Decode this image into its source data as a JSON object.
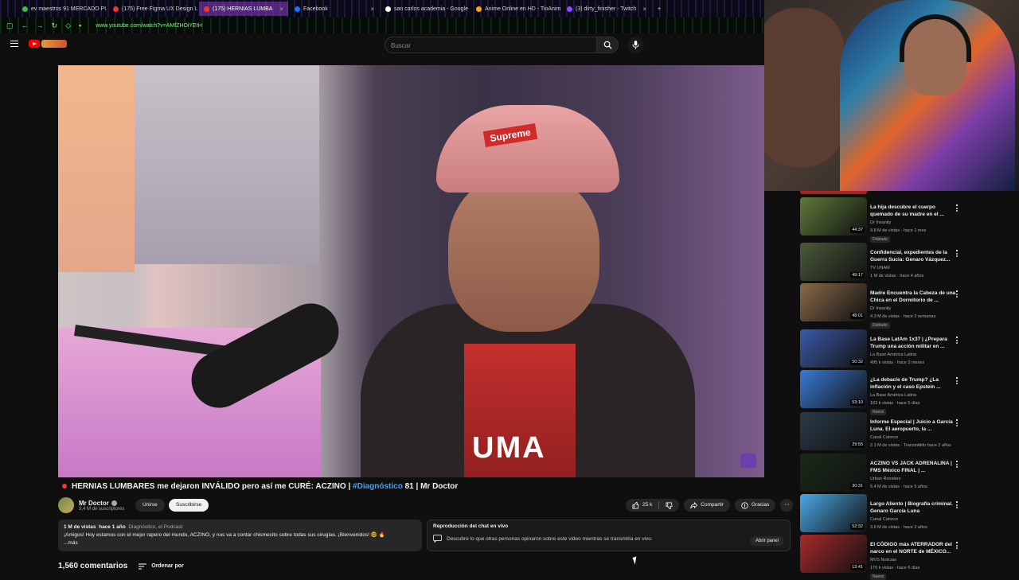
{
  "browser": {
    "tabs": [
      {
        "label": "ev maestros 91 MERCADO PUE",
        "color": "#4caf50",
        "active": false
      },
      {
        "label": "(175) Free Figma UX Design UI",
        "color": "#e53935",
        "active": false
      },
      {
        "label": "(175) HERNIAS LUMBA",
        "color": "#e53935",
        "active": true
      },
      {
        "label": "Facebook",
        "color": "#1877f2",
        "active": false
      },
      {
        "label": "san carlos academia - Google",
        "color": "#ffffff",
        "active": false
      },
      {
        "label": "Anime Online en HD - TioAnim",
        "color": "#f5a623",
        "active": false
      },
      {
        "label": "(3) dirty_finisher - Twitch",
        "color": "#9146ff",
        "active": false
      }
    ],
    "new_tab": "+",
    "url": "www.youtube.com/watch?v=AMfZHOiYEtH"
  },
  "header": {
    "search_placeholder": "Buscar"
  },
  "video": {
    "shirt_text": "UMA",
    "cap_text": "Supreme",
    "title_main": "HERNIAS LUMBARES me dejaron INVÁLIDO pero así me CURÉ: ACZINO | ",
    "title_tag": "#Diagnóstico",
    "title_end": " 81 | Mr Doctor"
  },
  "channel": {
    "name": "Mr Doctor",
    "subs": "3,4 M de suscriptores",
    "join": "Unirse",
    "subscribe": "Suscribirse"
  },
  "actions": {
    "likes": "25 k",
    "share": "Compartir",
    "thanks": "Gracias"
  },
  "description": {
    "views": "1 M de vistas",
    "date": "hace 1 año",
    "hashtags": "Diagnóstico, el Podcast",
    "text": "¡Amigos! Hoy estamos con el mejor rapero del mundo, ACZINO, y nos va a contar chismecito sobre todas sus cirugías. ¡Bienvenidos! 🤓 🔥",
    "more": "...más"
  },
  "chat": {
    "title": "Reproducción del chat en vivo",
    "text": "Descubre lo que otras personas opinaron sobre este video mientras se transmitía en vivo.",
    "open": "Abrir panel"
  },
  "comments": {
    "count": "1,560 comentarios",
    "sort": "Ordenar por"
  },
  "recommendations": [
    {
      "title": "La hija descubre el cuerpo quemado de su madre en el ...",
      "channel": "Dr Insanity",
      "views": "9.8 M de vistas · hace 1 mes",
      "badge": "Doblado",
      "duration": "44:37",
      "color": "#5f7a3a"
    },
    {
      "title": "Confidencial, expedientes de la Guerra Sucia: Genaro Vázquez...",
      "channel": "TV UNAM",
      "views": "1 M de vistas · hace 4 años",
      "badge": "",
      "duration": "49:17",
      "color": "#4a5a3a"
    },
    {
      "title": "Madre Encuentra la Cabeza de una Chica en el Dormitorio de ...",
      "channel": "Dr Insanity",
      "views": "4.3 M de vistas · hace 2 semanas",
      "badge": "Doblado",
      "duration": "48:01",
      "color": "#8a6a4a"
    },
    {
      "title": "La Base LatAm 1x37 | ¿Prepara Trump una acción militar en ...",
      "channel": "La Base América Latina",
      "views": "495 k vistas · hace 3 meses",
      "badge": "",
      "duration": "50:32",
      "color": "#3a5aa8"
    },
    {
      "title": "¿La debacle de Trump? ¿La inflación y el caso Epstein ...",
      "channel": "La Base América Latina",
      "views": "163 k vistas · hace 5 días",
      "badge": "Nuevo",
      "duration": "53:10",
      "color": "#3a7ad8"
    },
    {
      "title": "Informe Especial | Juicio a García Luna. El aeropuerto, la ...",
      "channel": "Canal Catorce",
      "views": "2.1 M de vistas · Transmitido hace 2 años",
      "badge": "",
      "duration": "29:55",
      "color": "#2a3a4a"
    },
    {
      "title": "ACZINO VS JACK ADRENALINA | FMS México FINAL | ...",
      "channel": "Urban Roosters",
      "views": "5.4 M de vistas · hace 5 años",
      "badge": "",
      "duration": "30:31",
      "color": "#1a2a1a"
    },
    {
      "title": "Largo Aliento | Biografía criminal. Genaro García Luna",
      "channel": "Canal Catorce",
      "views": "3.9 M de vistas · hace 2 años",
      "badge": "",
      "duration": "52:32",
      "color": "#4aa8e8"
    },
    {
      "title": "El CÓDIGO más ATERRADOR del narco en el NORTE de MÉXICO...",
      "channel": "MVS Noticias",
      "views": "170 k vistas · hace 6 días",
      "badge": "Nuevo",
      "duration": "13:41",
      "color": "#a82a2a"
    }
  ]
}
